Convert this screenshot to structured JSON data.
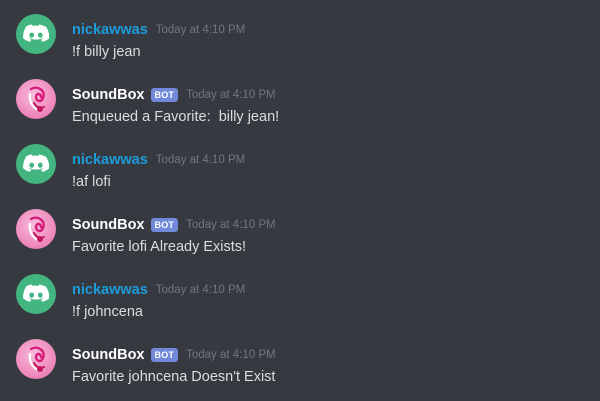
{
  "messages": [
    {
      "author": "nickawwas",
      "author_type": "user",
      "avatar_icon": "discord-logo-icon",
      "timestamp": "Today at 4:10 PM",
      "content": "!f billy jean"
    },
    {
      "author": "SoundBox",
      "author_type": "bot",
      "badge": "BOT",
      "avatar_icon": "soundbox-avatar-icon",
      "timestamp": "Today at 4:10 PM",
      "content": "Enqueued a Favorite:  billy jean!"
    },
    {
      "author": "nickawwas",
      "author_type": "user",
      "avatar_icon": "discord-logo-icon",
      "timestamp": "Today at 4:10 PM",
      "content": "!af lofi"
    },
    {
      "author": "SoundBox",
      "author_type": "bot",
      "badge": "BOT",
      "avatar_icon": "soundbox-avatar-icon",
      "timestamp": "Today at 4:10 PM",
      "content": "Favorite lofi Already Exists!"
    },
    {
      "author": "nickawwas",
      "author_type": "user",
      "avatar_icon": "discord-logo-icon",
      "timestamp": "Today at 4:10 PM",
      "content": "!f johncena"
    },
    {
      "author": "SoundBox",
      "author_type": "bot",
      "badge": "BOT",
      "avatar_icon": "soundbox-avatar-icon",
      "timestamp": "Today at 4:10 PM",
      "content": "Favorite johncena Doesn't Exist"
    }
  ],
  "colors": {
    "background": "#36393f",
    "user_name": "#1c9ddb",
    "bot_name": "#ffffff",
    "bot_badge": "#7289da",
    "timestamp": "#72767d",
    "message_text": "#dcddde",
    "user_avatar": "#43b581",
    "bot_avatar": "#f08fc0"
  }
}
